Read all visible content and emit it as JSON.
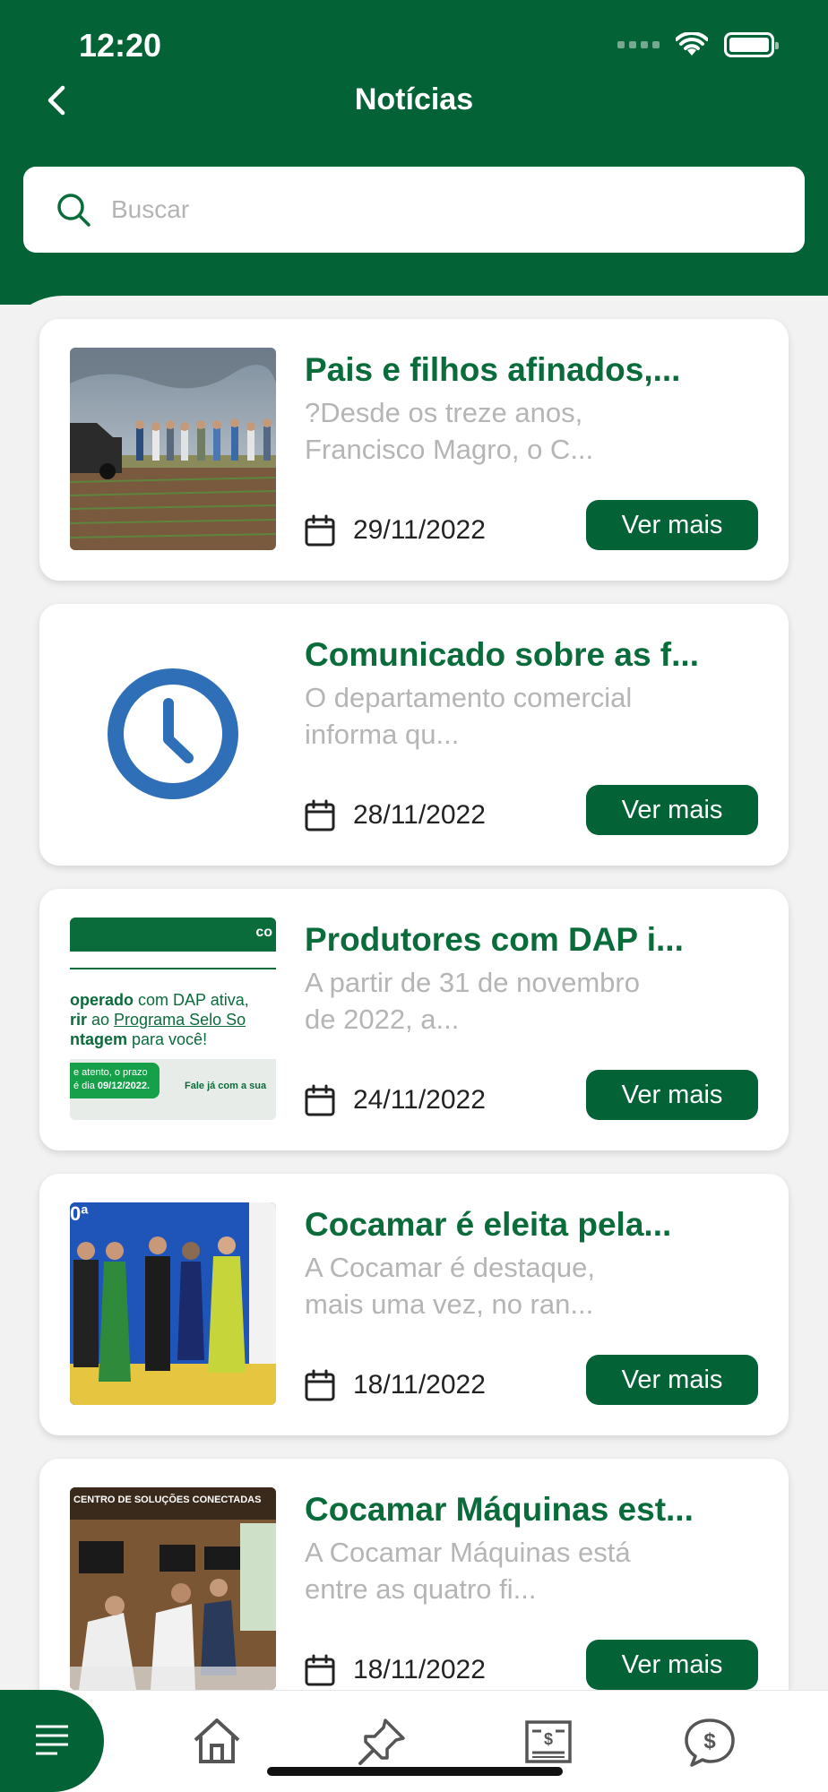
{
  "status_bar": {
    "time": "12:20"
  },
  "nav": {
    "title": "Notícias",
    "back_icon": "chevron-left-icon"
  },
  "search": {
    "placeholder": "Buscar",
    "value": ""
  },
  "news": [
    {
      "title": "Pais e filhos afinados,...",
      "description": "?Desde os treze anos, Francisco Magro, o C...",
      "date": "29/11/2022",
      "button": "Ver mais",
      "image": "field-photo"
    },
    {
      "title": "Comunicado sobre as f...",
      "description": "O departamento comercial informa qu...",
      "date": "28/11/2022",
      "button": "Ver mais",
      "image": "clock-icon"
    },
    {
      "title": "Produtores com DAP i...",
      "description": "A partir de 31 de novembro de 2022, a...",
      "date": "24/11/2022",
      "button": "Ver mais",
      "image": "promo-banner",
      "banner": {
        "logo": "co",
        "line1a": "operado",
        "line1b": " com DAP ativa,",
        "line2a": "rir",
        "line2b": " ao ",
        "line2c": "Programa Selo So",
        "line3a": "ntagem",
        "line3b": " para você!",
        "pill1": "e atento, o prazo",
        "pill2": "é dia ",
        "pill2b": "09/12/2022.",
        "cta": "Fale já com a sua"
      }
    },
    {
      "title": "Cocamar é eleita pela...",
      "description": "A Cocamar é destaque, mais uma vez, no ran...",
      "date": "18/11/2022",
      "button": "Ver mais",
      "image": "award-photo",
      "photo_label": "0ª"
    },
    {
      "title": "Cocamar Máquinas est...",
      "description": "A Cocamar Máquinas está entre as quatro fi...",
      "date": "18/11/2022",
      "button": "Ver mais",
      "image": "booth-photo",
      "photo_label": "CENTRO DE SOLUÇÕES CONECTADAS"
    }
  ],
  "tabbar": {
    "items": [
      "list-icon",
      "home-icon",
      "pin-icon",
      "invoice-icon",
      "chat-dollar-icon"
    ],
    "active": "list-icon"
  },
  "colors": {
    "primary": "#046237",
    "title": "#0a6b3b",
    "clock_blue": "#2f6fb8"
  }
}
